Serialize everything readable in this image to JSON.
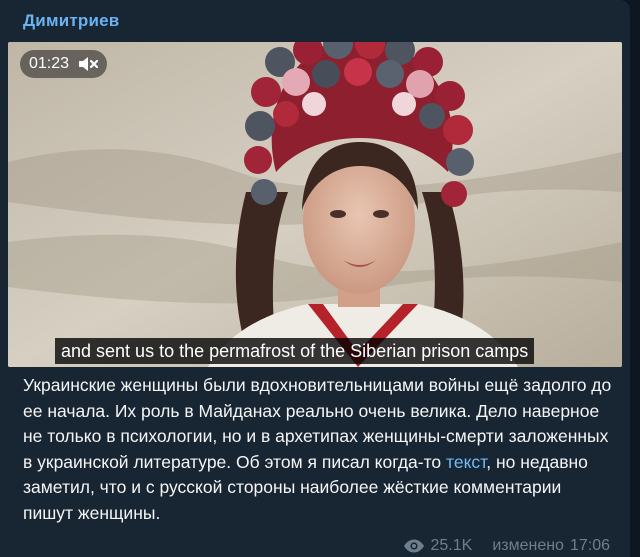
{
  "post": {
    "author": "Димитриев",
    "video": {
      "duration": "01:23",
      "subtitle": "and sent us to the permafrost of the Siberian prison camps"
    },
    "text": {
      "before_link": "Украинские женщины были вдохновительницами войны ещё задолго до ее начала. Их роль в Майданах реально очень велика. Дело наверное не только в психологии, но и в архетипах женщины-смерти заложенных в украинской литературе. Об этом я писал когда-то ",
      "link": "текст",
      "after_link": ", но недавно заметил, что и с русской стороны наиболее жёсткие комментарии пишут женщины."
    },
    "views": "25.1K",
    "edited_label": "изменено",
    "time": "17:06"
  },
  "icons": {
    "mute": "mute-icon",
    "views": "eye-icon"
  },
  "colors": {
    "background": "#0e1621",
    "bubble": "#182533",
    "author": "#6ab2f2",
    "link": "#71baf7",
    "meta": "#6d7f8f"
  }
}
